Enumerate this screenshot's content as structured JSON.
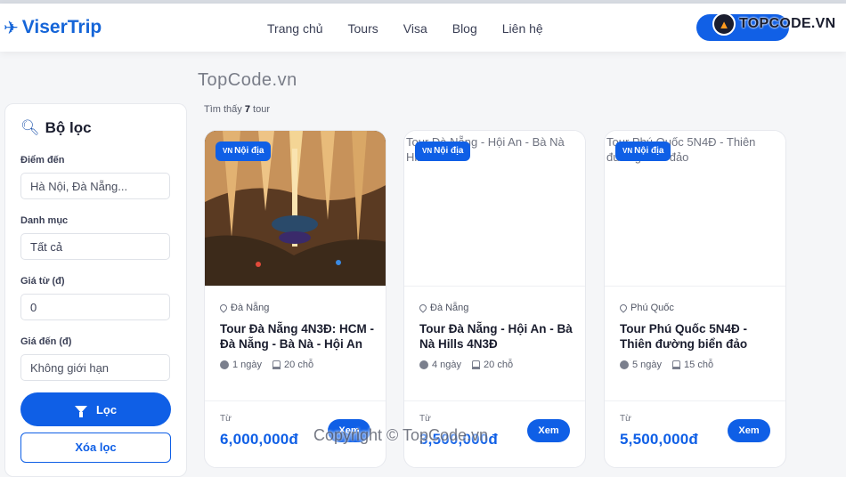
{
  "brand": {
    "name": "ViserTrip",
    "plane_icon": "airplane-icon",
    "color": "#1565d8"
  },
  "nav": {
    "links": [
      "Trang chủ",
      "Tours",
      "Visa",
      "Blog",
      "Liên hệ"
    ],
    "button_color": "#1160e6"
  },
  "watermark": {
    "badge_text": "TOPCODE.VN",
    "top_text": "TopCode.vn",
    "bottom_text": "Copyright © TopCode.vn"
  },
  "filter": {
    "title": "Bộ lọc",
    "icon": "magnifier-icon",
    "destination_label": "Điểm đến",
    "destination_placeholder": "Hà Nội, Đà Nẵng...",
    "category_label": "Danh mục",
    "category_value": "Tất cả",
    "price_from_label": "Giá từ (đ)",
    "price_from_value": "0",
    "price_to_label": "Giá đến (đ)",
    "price_to_placeholder": "Không giới hạn",
    "filter_button": "Lọc",
    "clear_button": "Xóa lọc"
  },
  "results": {
    "prefix": "Tìm thấy",
    "count": "7",
    "suffix": "tour"
  },
  "accent_color": "#0f5fe6",
  "tours": [
    {
      "badge_flag": "VN",
      "badge": "Nội địa",
      "image_alt": "",
      "location": "Đà Nẵng",
      "title": "Tour Đà Nẵng 4N3Đ: HCM - Đà Nẵng - Bà Nà - Hội An",
      "days": "1 ngày",
      "seats": "20 chỗ",
      "from_label": "Từ",
      "price": "6,000,000đ",
      "view": "Xem"
    },
    {
      "badge_flag": "VN",
      "badge": "Nội địa",
      "image_alt": "Tour Đà Nẵng - Hội An - Bà Nà Hills 4N3Đ",
      "location": "Đà Nẵng",
      "title": "Tour Đà Nẵng - Hội An - Bà Nà Hills 4N3Đ",
      "days": "4 ngày",
      "seats": "20 chỗ",
      "from_label": "Từ",
      "price": "3,500,000đ",
      "view": "Xem"
    },
    {
      "badge_flag": "VN",
      "badge": "Nội địa",
      "image_alt": "Tour Phú Quốc 5N4Đ - Thiên đường biển đảo",
      "location": "Phú Quốc",
      "title": "Tour Phú Quốc 5N4Đ - Thiên đường biển đảo",
      "days": "5 ngày",
      "seats": "15 chỗ",
      "from_label": "Từ",
      "price": "5,500,000đ",
      "view": "Xem"
    }
  ]
}
